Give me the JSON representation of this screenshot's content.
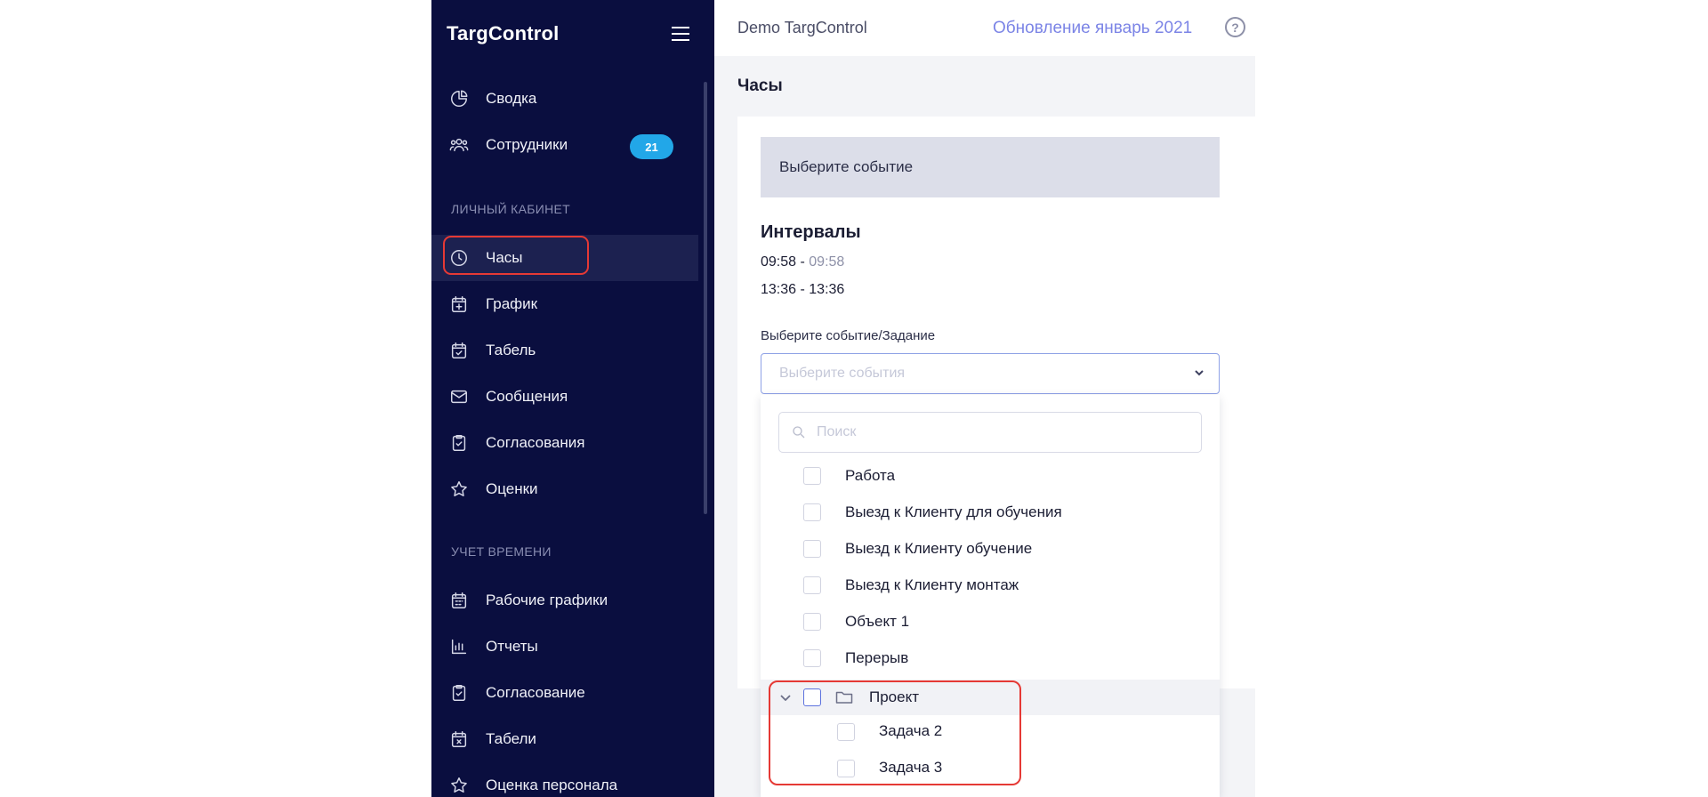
{
  "app": {
    "logo": "TargControl",
    "workspace": "Demo TargControl",
    "update_link": "Обновление январь 2021",
    "help": "?"
  },
  "sidebar": {
    "items_top": [
      {
        "label": "Сводка",
        "icon": "pie-chart-icon"
      },
      {
        "label": "Сотрудники",
        "icon": "users-icon",
        "badge": "21"
      }
    ],
    "section_personal": "ЛИЧНЫЙ КАБИНЕТ",
    "items_personal": [
      {
        "label": "Часы",
        "icon": "clock-icon",
        "active": true
      },
      {
        "label": "График",
        "icon": "calendar-plus-icon"
      },
      {
        "label": "Табель",
        "icon": "calendar-check-icon"
      },
      {
        "label": "Сообщения",
        "icon": "mail-icon"
      },
      {
        "label": "Согласования",
        "icon": "clipboard-check-icon"
      },
      {
        "label": "Оценки",
        "icon": "star-icon"
      }
    ],
    "section_time": "УЧЕТ ВРЕМЕНИ",
    "items_time": [
      {
        "label": "Рабочие графики",
        "icon": "calendar-grid-icon"
      },
      {
        "label": "Отчеты",
        "icon": "bar-chart-icon"
      },
      {
        "label": "Согласование",
        "icon": "clipboard-check-icon"
      },
      {
        "label": "Табели",
        "icon": "calendar-x-icon"
      },
      {
        "label": "Оценка персонала",
        "icon": "star-icon"
      }
    ],
    "badge_color": "#22a7e8"
  },
  "main": {
    "page_title": "Часы",
    "event_select": "Выберите событие",
    "intervals_title": "Интервалы",
    "intervals": [
      {
        "start": "09:58",
        "end": "09:58",
        "end_muted": true
      },
      {
        "start": "13:36",
        "end": "13:36",
        "end_muted": false
      }
    ],
    "field_label": "Выберите событие/Задание",
    "select_placeholder": "Выберите события"
  },
  "dropdown": {
    "search_placeholder": "Поиск",
    "options": [
      "Работа",
      "Выезд к Клиенту для обучения",
      "Выезд к Клиенту обучение",
      "Выезд к Клиенту монтаж",
      "Объект 1",
      "Перерыв"
    ],
    "folder": {
      "label": "Проект",
      "expanded": true,
      "children": [
        "Задача 2",
        "Задача 3"
      ]
    }
  }
}
